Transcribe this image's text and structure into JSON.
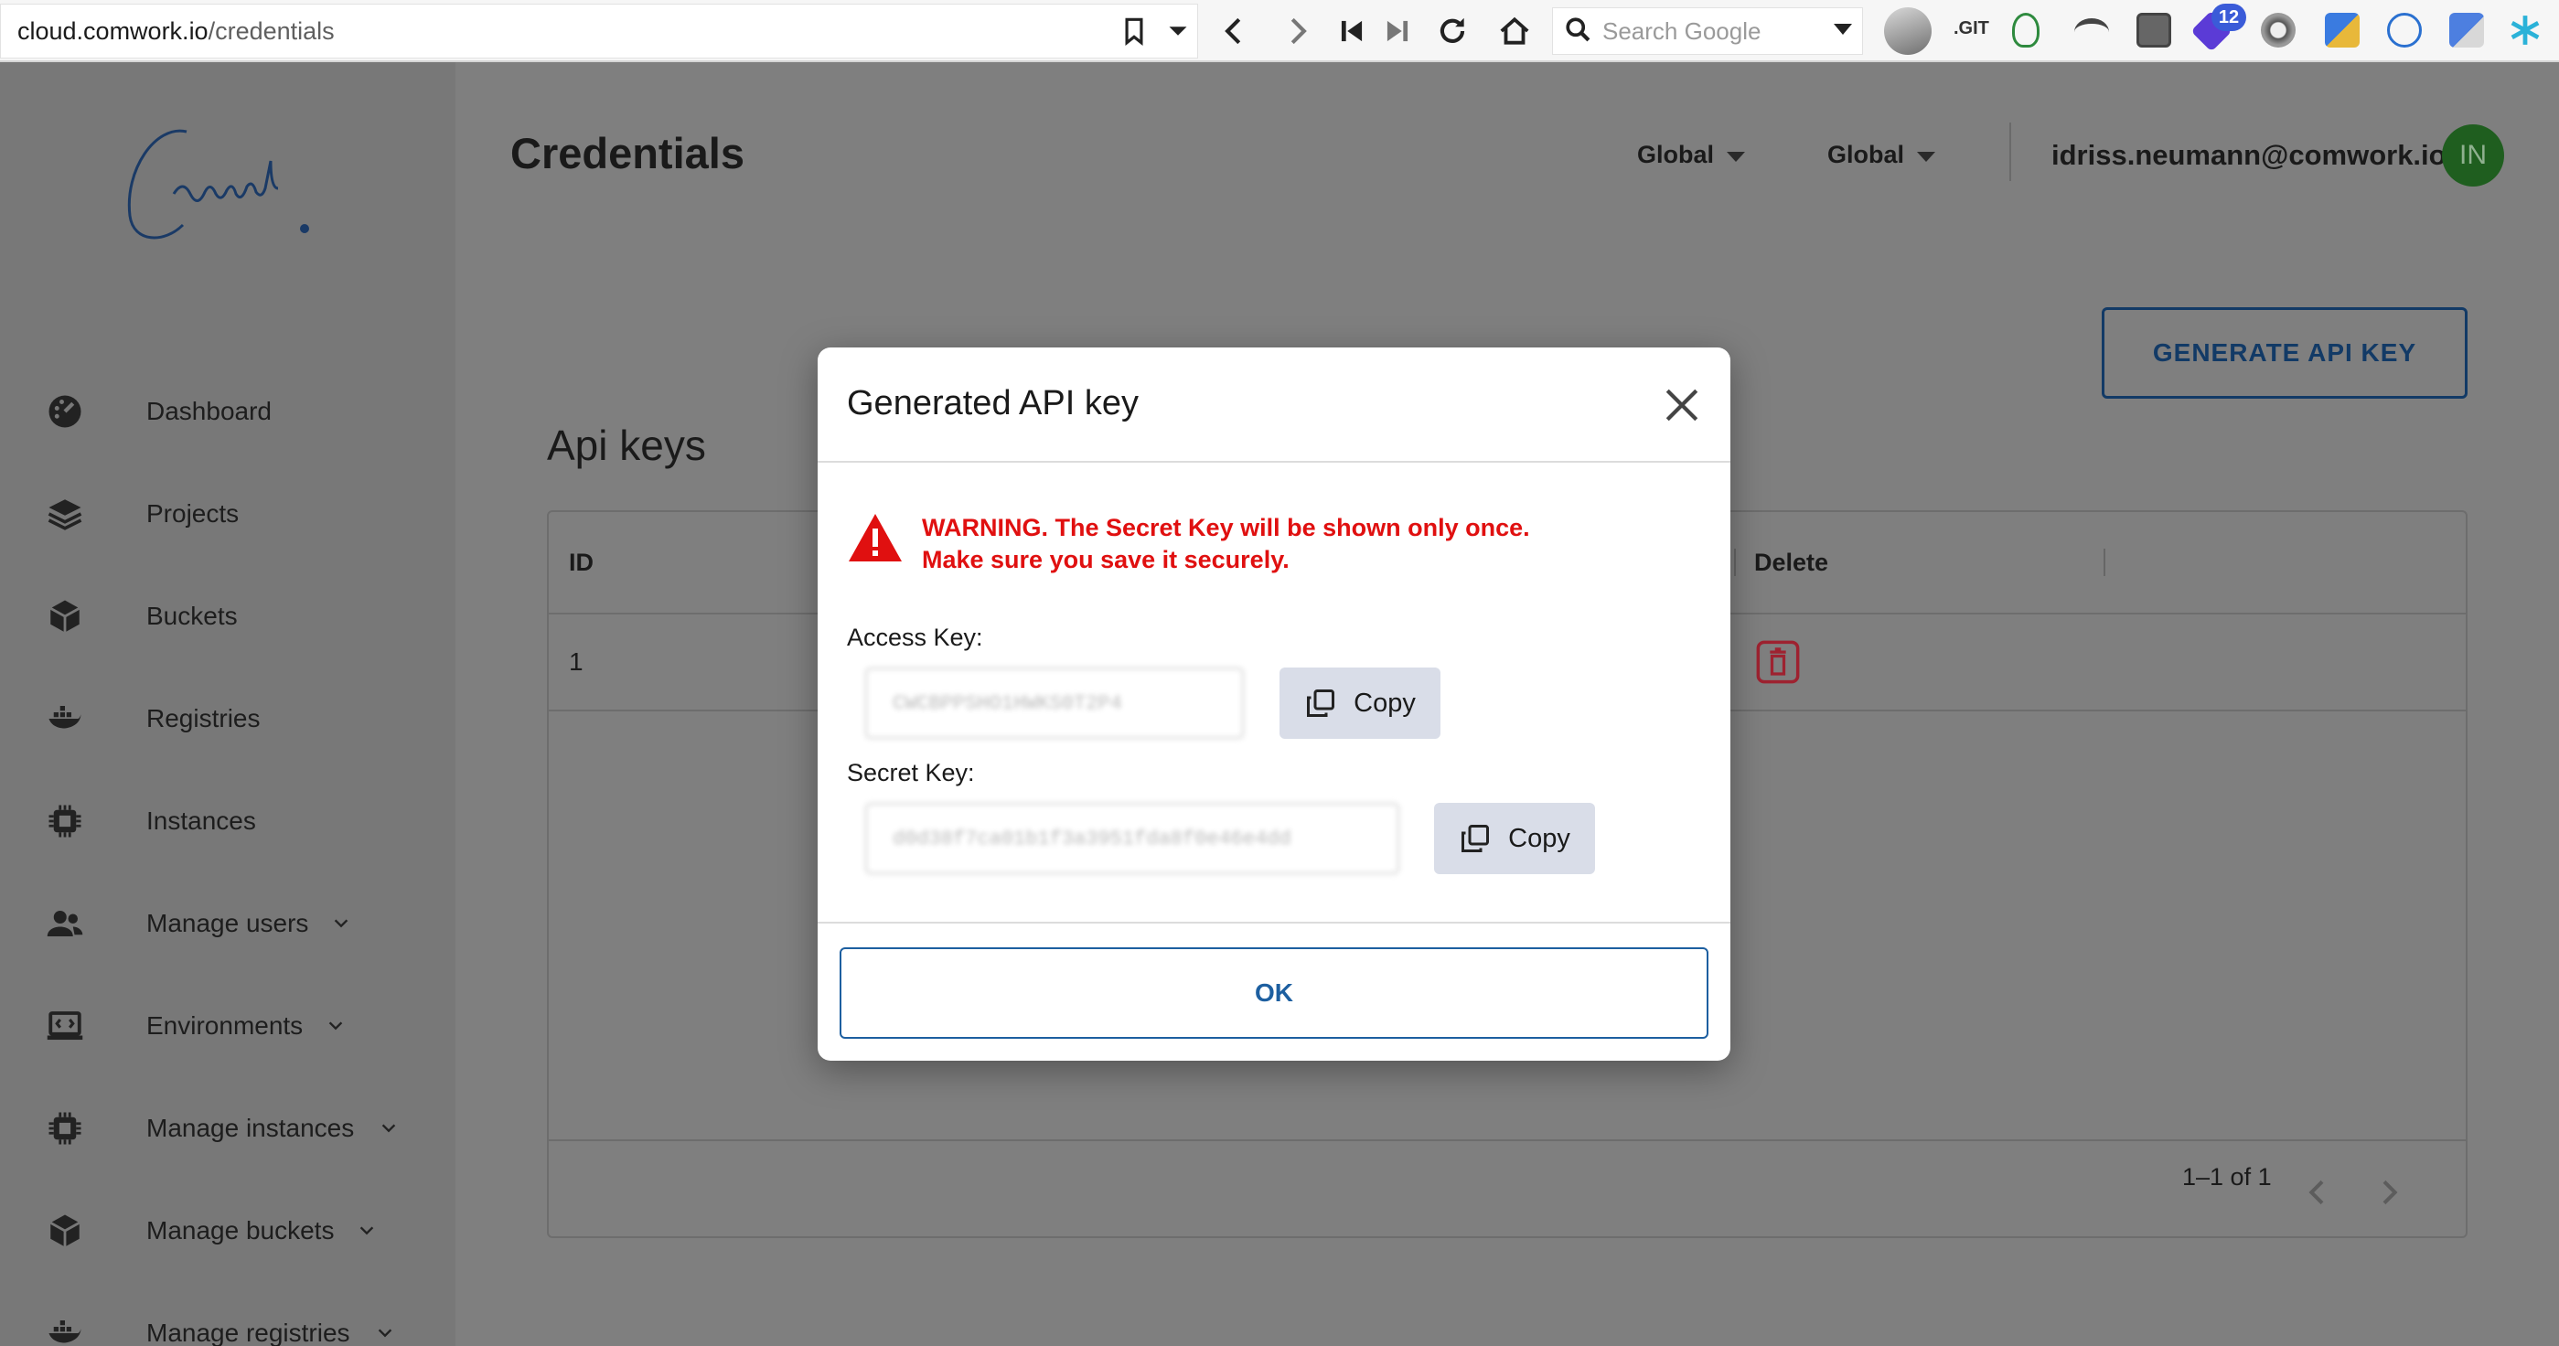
{
  "browser": {
    "url_host": "cloud.comwork.io",
    "url_path": "/credentials",
    "search_placeholder": "Search Google",
    "git_label": ".GIT",
    "ext_badge_count": "12"
  },
  "header": {
    "title": "Credentials",
    "scope_1": "Global",
    "scope_2": "Global",
    "user_email": "idriss.neumann@comwork.io",
    "user_initials": "IN"
  },
  "sidebar": {
    "items": [
      {
        "label": "Dashboard",
        "icon": "dashboard-icon",
        "has_chevron": false
      },
      {
        "label": "Projects",
        "icon": "layers-icon",
        "has_chevron": false
      },
      {
        "label": "Buckets",
        "icon": "box-icon",
        "has_chevron": false
      },
      {
        "label": "Registries",
        "icon": "docker-icon",
        "has_chevron": false
      },
      {
        "label": "Instances",
        "icon": "chip-icon",
        "has_chevron": false
      },
      {
        "label": "Manage users",
        "icon": "users-icon",
        "has_chevron": true
      },
      {
        "label": "Environments",
        "icon": "terminal-icon",
        "has_chevron": true
      },
      {
        "label": "Manage instances",
        "icon": "chip-icon",
        "has_chevron": true
      },
      {
        "label": "Manage buckets",
        "icon": "box-icon",
        "has_chevron": true
      },
      {
        "label": "Manage registries",
        "icon": "docker-icon",
        "has_chevron": true
      }
    ]
  },
  "main": {
    "generate_button": "GENERATE API KEY",
    "section_title": "Api keys",
    "table": {
      "columns": [
        "ID",
        "Delete"
      ],
      "rows": [
        {
          "id": "1"
        }
      ],
      "pagination": "1–1 of 1"
    }
  },
  "modal": {
    "title": "Generated API key",
    "warning_line1": "WARNING. The Secret Key will be shown only once.",
    "warning_line2": "Make sure you save it securely.",
    "access_label": "Access Key:",
    "access_value": "CWCBPPSHO1HWKS0T2P4",
    "secret_label": "Secret Key:",
    "secret_value": "d0d38f7ca01b1f3a3951fda8f0e46e4dd",
    "copy_label": "Copy",
    "ok_label": "OK"
  },
  "colors": {
    "warning": "#e01010",
    "primary": "#1d5fa0",
    "overlay": "#7f7f7f",
    "avatar_bg": "#1f5e1f"
  }
}
